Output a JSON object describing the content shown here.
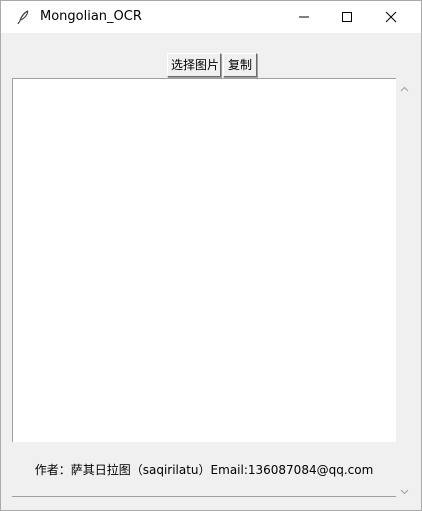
{
  "window": {
    "title": "Mongolian_OCR",
    "controls": {
      "minimize_icon": "minimize-icon",
      "maximize_icon": "maximize-icon",
      "close_icon": "close-icon"
    }
  },
  "toolbar": {
    "select_image_label": "选择图片",
    "copy_label": "复制"
  },
  "main": {
    "text_content": ""
  },
  "footer": {
    "credit": "作者：萨其日拉图（saqirilatu）Email:136087084@qq.com"
  },
  "colors": {
    "window_bg": "#f0f0f0",
    "titlebar_bg": "#ffffff",
    "text_area_bg": "#ffffff"
  }
}
